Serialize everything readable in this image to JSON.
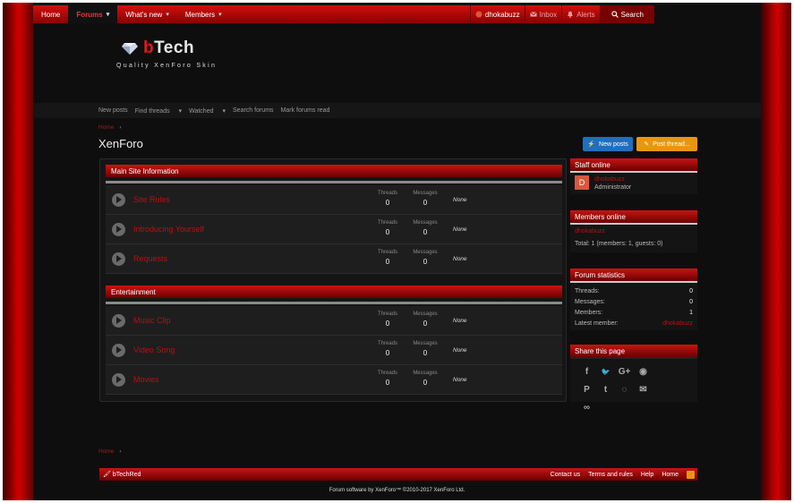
{
  "topnav": {
    "items": [
      {
        "label": "Home"
      },
      {
        "label": "Forums",
        "active": true
      },
      {
        "label": "What's new"
      },
      {
        "label": "Members"
      }
    ],
    "user": "dhokabuzz",
    "inbox": "Inbox",
    "alerts": "Alerts",
    "search": "Search",
    "chevron": "▾"
  },
  "logo": {
    "name_prefix": "b",
    "name_rest": "Tech",
    "tagline": "Quality XenForo Skin"
  },
  "subnav": {
    "items": [
      "New posts",
      "Find threads",
      "Watched",
      "Search forums",
      "Mark forums read"
    ]
  },
  "breadcrumb": {
    "home": "Home",
    "sep": "›"
  },
  "page": {
    "title": "XenForo",
    "new_posts": "New posts",
    "post_thread": "Post thread..."
  },
  "labels": {
    "threads": "Threads",
    "messages": "Messages",
    "none": "None"
  },
  "categories": [
    {
      "title": "Main Site Information",
      "nodes": [
        {
          "title": "Site Rules",
          "threads": "0",
          "messages": "0"
        },
        {
          "title": "Introducing Yourself",
          "threads": "0",
          "messages": "0"
        },
        {
          "title": "Requests",
          "threads": "0",
          "messages": "0"
        }
      ]
    },
    {
      "title": "Entertainment",
      "nodes": [
        {
          "title": "Music Clip",
          "threads": "0",
          "messages": "0"
        },
        {
          "title": "Video Song",
          "threads": "0",
          "messages": "0"
        },
        {
          "title": "Movies",
          "threads": "0",
          "messages": "0"
        }
      ]
    }
  ],
  "sidebar": {
    "staff": {
      "title": "Staff online",
      "avatar_letter": "D",
      "name": "dhokabuzz",
      "role": "Administrator"
    },
    "members": {
      "title": "Members online",
      "name": "dhokabuzz",
      "total": "Total: 1 (members: 1, guests: 0)"
    },
    "stats": {
      "title": "Forum statistics",
      "rows": [
        {
          "label": "Threads:",
          "value": "0"
        },
        {
          "label": "Messages:",
          "value": "0"
        },
        {
          "label": "Members:",
          "value": "1"
        },
        {
          "label": "Latest member:",
          "value": "dhokabuzz"
        }
      ]
    },
    "share": {
      "title": "Share this page",
      "icons": [
        {
          "name": "facebook-icon",
          "glyph": "f"
        },
        {
          "name": "twitter-icon",
          "glyph": "🐦"
        },
        {
          "name": "google-plus-icon",
          "glyph": "G+"
        },
        {
          "name": "reddit-icon",
          "glyph": "◉"
        },
        {
          "name": "pinterest-icon",
          "glyph": "P"
        },
        {
          "name": "tumblr-icon",
          "glyph": "t"
        },
        {
          "name": "whatsapp-icon",
          "glyph": "◌"
        },
        {
          "name": "email-icon",
          "glyph": "✉"
        },
        {
          "name": "link-icon",
          "glyph": "∞"
        }
      ]
    }
  },
  "footer": {
    "brand": "bTechRed",
    "links": [
      "Contact us",
      "Terms and rules",
      "Help",
      "Home"
    ],
    "copyright": "Forum software by XenForo™ ©2010-2017 XenForo Ltd."
  }
}
